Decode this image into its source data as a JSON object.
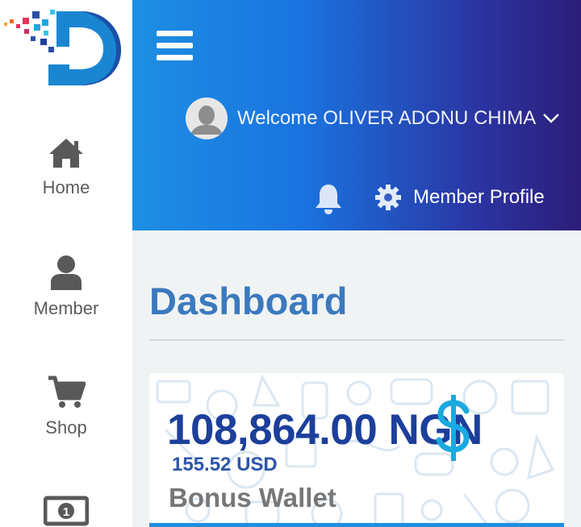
{
  "app": {
    "logo_letter": "D"
  },
  "sidebar": {
    "items": [
      {
        "label": "Home",
        "icon": "home-icon"
      },
      {
        "label": "Member",
        "icon": "user-icon"
      },
      {
        "label": "Shop",
        "icon": "cart-icon"
      },
      {
        "label": "",
        "icon": "banknote-icon"
      }
    ]
  },
  "header": {
    "welcome_text": "Welcome OLIVER ADONU CHIMA",
    "profile_label": "Member Profile",
    "menu_icon": "hamburger-icon",
    "notification_icon": "bell-icon",
    "settings_icon": "gear-icon"
  },
  "main": {
    "title": "Dashboard",
    "wallet_card": {
      "amount": "108,864.00 NGN",
      "secondary_amount": "155.52 USD",
      "label": "Bonus Wallet"
    }
  },
  "colors": {
    "header_gradient_start": "#1d8fe3",
    "header_gradient_end": "#2c1d78",
    "title_blue": "#3b79be",
    "amount_blue": "#1c3f9b",
    "dollar_cyan": "#1aa9e0",
    "page_background": "#f0f3f3"
  }
}
